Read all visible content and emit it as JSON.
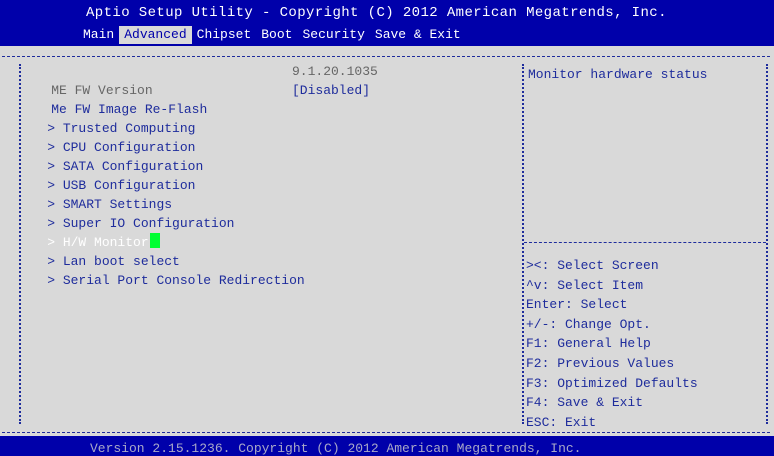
{
  "header": {
    "title": "Aptio Setup Utility - Copyright (C) 2012 American Megatrends, Inc.",
    "tabs": [
      {
        "label": "Main"
      },
      {
        "label": "Advanced",
        "active": true
      },
      {
        "label": "Chipset"
      },
      {
        "label": "Boot"
      },
      {
        "label": "Security"
      },
      {
        "label": "Save & Exit"
      }
    ]
  },
  "menu": {
    "items": [
      {
        "label": "ME FW Version",
        "value": "9.1.20.1035",
        "type": "readonly"
      },
      {
        "label": "Me FW Image Re-Flash",
        "value": "[Disabled]",
        "type": "option"
      },
      {
        "label": "Trusted Computing",
        "marker": "> ",
        "type": "submenu"
      },
      {
        "label": "CPU Configuration",
        "marker": "> ",
        "type": "submenu"
      },
      {
        "label": "SATA Configuration",
        "marker": "> ",
        "type": "submenu"
      },
      {
        "label": "USB Configuration",
        "marker": "> ",
        "type": "submenu"
      },
      {
        "label": "SMART Settings",
        "marker": "> ",
        "type": "submenu"
      },
      {
        "label": "Super IO Configuration",
        "marker": "> ",
        "type": "submenu"
      },
      {
        "label": "H/W Monitor",
        "marker": "> ",
        "type": "submenu",
        "selected": true
      },
      {
        "label": "Lan boot select",
        "marker": "> ",
        "type": "submenu"
      },
      {
        "label": "Serial Port Console Redirection",
        "marker": "> ",
        "type": "submenu"
      }
    ]
  },
  "help": {
    "description": "Monitor hardware status",
    "keys": [
      "><: Select Screen",
      "^v: Select Item",
      "Enter: Select",
      "+/-: Change Opt.",
      "F1: General Help",
      "F2: Previous Values",
      "F3: Optimized Defaults",
      "F4: Save & Exit",
      "ESC: Exit"
    ]
  },
  "footer": {
    "text": "Version 2.15.1236. Copyright (C) 2012 American Megatrends, Inc."
  },
  "colors": {
    "header_bg": "#0000aa",
    "body_bg": "#d9d9d9",
    "text": "#1e2c9c",
    "selected_text": "#ffffff",
    "cursor": "#00ff33",
    "readonly_text": "#666666"
  }
}
